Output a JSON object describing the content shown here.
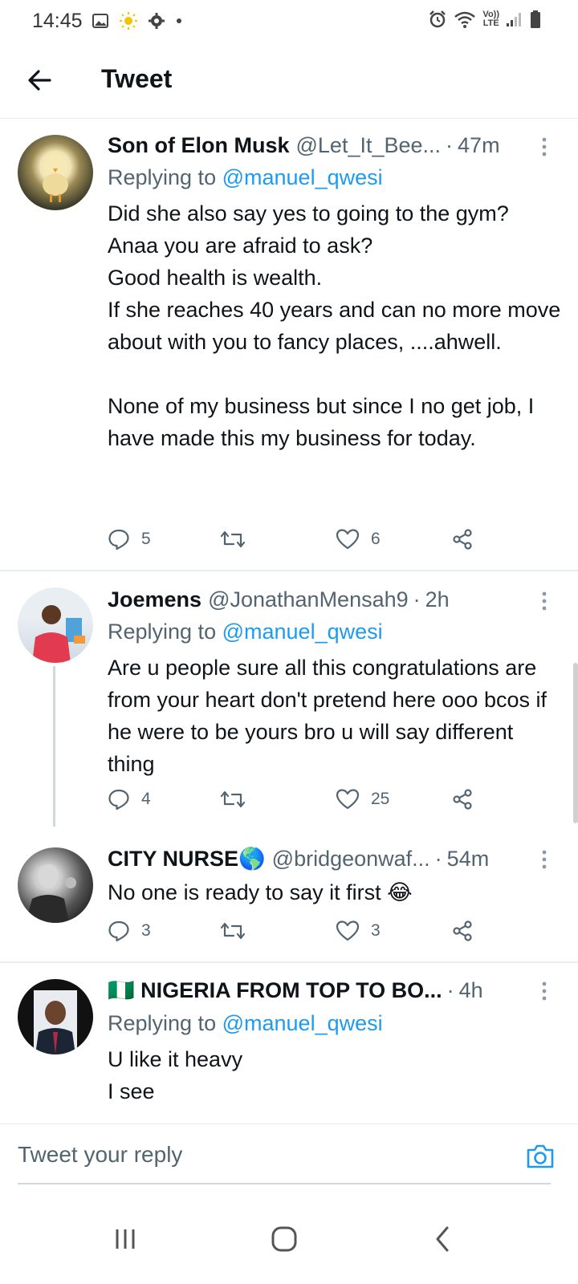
{
  "status_bar": {
    "time": "14:45",
    "left_icons": [
      "image-icon",
      "sun-icon",
      "gear-icon",
      "dot-icon"
    ],
    "right_icons": [
      "alarm-icon",
      "wifi-icon",
      "volte-icon",
      "signal-icon",
      "battery-icon"
    ],
    "volte_line1": "Vo))",
    "volte_line2": "LTE"
  },
  "header": {
    "title": "Tweet"
  },
  "tweets": [
    {
      "name": "Son of Elon Musk",
      "handle": "@Let_It_Bee...",
      "time": "47m",
      "replying_label": "Replying to",
      "replying_to": "@manuel_qwesi",
      "text": "Did she also say yes to going to the gym?\nAnaa you are afraid to ask?\nGood health is wealth.\nIf she reaches 40 years and can no more move about with you to fancy places, ....ahwell.\n\nNone of my business but since I no get job, I have made this my business for today.",
      "replies": "5",
      "retweets": "",
      "likes": "6"
    },
    {
      "name": "Joemens",
      "handle": "@JonathanMensah9",
      "time": "2h",
      "replying_label": "Replying to",
      "replying_to": "@manuel_qwesi",
      "text": "Are u people sure all this congratulations are from your heart don't pretend here ooo bcos if he were to be yours bro u will say different thing",
      "replies": "4",
      "retweets": "",
      "likes": "25"
    },
    {
      "name": "CITY NURSE🌎",
      "handle": "@bridgeonwaf...",
      "time": "54m",
      "text": "No one is ready to say it first 😂",
      "replies": "3",
      "retweets": "",
      "likes": "3"
    },
    {
      "name": "🇳🇬 NIGERIA FROM TOP TO BO...",
      "handle": "",
      "time": "4h",
      "replying_label": "Replying to",
      "replying_to": "@manuel_qwesi",
      "text": "U like it heavy\nI see"
    }
  ],
  "compose": {
    "placeholder": "Tweet your reply"
  },
  "colors": {
    "accent": "#1d9bf0",
    "secondary_text": "#536471",
    "divider": "#e6ecf0"
  }
}
